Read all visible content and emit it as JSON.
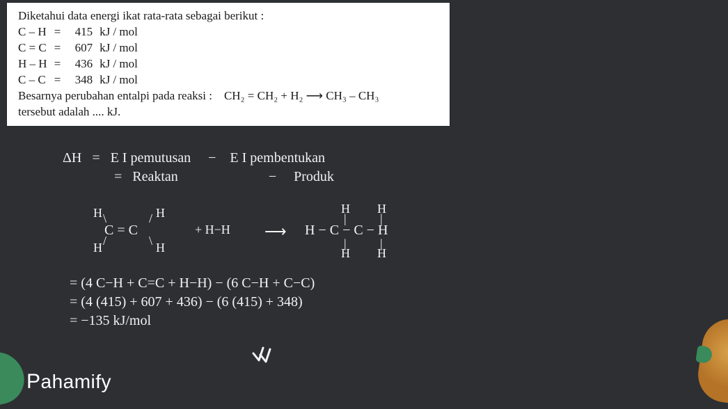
{
  "problem": {
    "intro": "Diketahui data energi ikat rata-rata sebagai berikut :",
    "bonds": [
      {
        "label": "C – H",
        "eq": "=",
        "value": "415",
        "unit": "kJ / mol"
      },
      {
        "label": "C = C",
        "eq": "=",
        "value": "607",
        "unit": "kJ / mol"
      },
      {
        "label": "H – H",
        "eq": "=",
        "value": "436",
        "unit": "kJ / mol"
      },
      {
        "label": "C – C",
        "eq": "=",
        "value": "348",
        "unit": "kJ / mol"
      }
    ],
    "question_start": "Besarnya perubahan entalpi pada reaksi :",
    "reaction_line": "CH₂ = CH₂   +   H₂   ⟶   CH₃ – CH₃",
    "question_end": "tersebut adalah .... kJ."
  },
  "solution": {
    "dh_label": "ΔH",
    "eq": "=",
    "rhs1_left": "E I pemutusan",
    "minus": "−",
    "rhs1_right": "E I pembentukan",
    "rhs2_left": "Reaktan",
    "rhs2_right": "Produk",
    "reaction": {
      "left_H_tl": "H",
      "left_H_tr": "H",
      "left_H_bl": "H",
      "left_H_br": "H",
      "left_core": "C = C",
      "plus": "+ H−H",
      "arrow": "⟶",
      "right_top_H1": "H",
      "right_top_H2": "H",
      "right_core": "H − C − C − H",
      "right_bot_H1": "H",
      "right_bot_H2": "H"
    },
    "calc": {
      "line1": "= (4 C−H + C=C + H−H) − (6 C−H + C−C)",
      "line2": "= (4 (415) + 607 + 436) − (6 (415) + 348)",
      "line3": "= −135 kJ/mol"
    }
  },
  "brand": "Pahamify"
}
